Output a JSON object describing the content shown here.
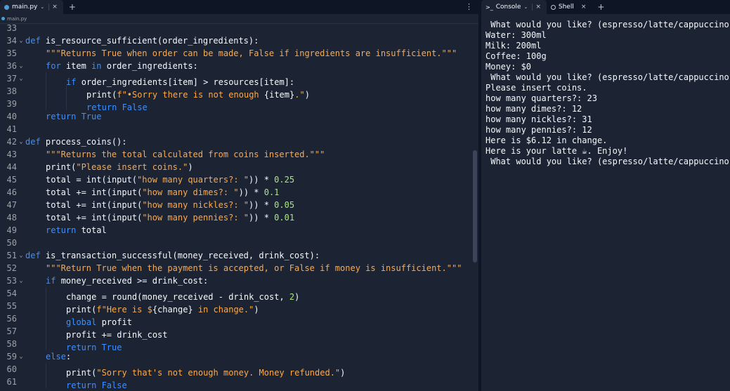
{
  "editor": {
    "tab_label": "main.py",
    "breadcrumb_label": "main.py",
    "tab_close": "×",
    "add_tab": "+",
    "kebab": "⋮"
  },
  "console": {
    "tab_console_label": "Console",
    "tab_shell_label": "Shell",
    "tab_close": "×",
    "add_tab": "+",
    "output": [
      " What would you like? (espresso/latte/cappuccino):",
      "Water: 300ml",
      "Milk: 200ml",
      "Coffee: 100g",
      "Money: $0",
      " What would you like? (espresso/latte/cappuccino):",
      "Please insert coins.",
      "how many quarters?: 23",
      "how many dimes?: 12",
      "how many nickles?: 31",
      "how many pennies?: 12",
      "Here is $6.12 in change.",
      "Here is your latte ☕. Enjoy!",
      " What would you like? (espresso/latte/cappuccino):"
    ]
  },
  "code_lines": [
    {
      "n": "33",
      "fold": "",
      "indent": 0,
      "tokens": []
    },
    {
      "n": "34",
      "fold": "⌄",
      "indent": 0,
      "tokens": [
        [
          "kw",
          "def "
        ],
        [
          "fn",
          "is_resource_sufficient"
        ],
        [
          "op",
          "(order_ingredients):"
        ]
      ]
    },
    {
      "n": "35",
      "fold": "",
      "indent": 1,
      "tokens": [
        [
          "str",
          "\"\"\"Returns True when order can be made, False if ingredients are insufficient.\"\"\""
        ]
      ]
    },
    {
      "n": "36",
      "fold": "⌄",
      "indent": 1,
      "tokens": [
        [
          "kw",
          "for "
        ],
        [
          "op",
          "item "
        ],
        [
          "kw",
          "in "
        ],
        [
          "op",
          "order_ingredients:"
        ]
      ]
    },
    {
      "n": "37",
      "fold": "⌄",
      "indent": 2,
      "tokens": [
        [
          "kw",
          "if "
        ],
        [
          "op",
          "order_ingredients[item] > resources[item]:"
        ]
      ]
    },
    {
      "n": "38",
      "fold": "",
      "indent": 3,
      "tokens": [
        [
          "fn",
          "print"
        ],
        [
          "op",
          "("
        ],
        [
          "str",
          "f\"•Sorry there is not enough "
        ],
        [
          "op",
          "{item}"
        ],
        [
          "str",
          "."
        ],
        [
          "str",
          "\""
        ],
        [
          "op",
          ")"
        ]
      ]
    },
    {
      "n": "39",
      "fold": "",
      "indent": 3,
      "tokens": [
        [
          "kw",
          "return "
        ],
        [
          "kw",
          "False"
        ]
      ]
    },
    {
      "n": "40",
      "fold": "",
      "indent": 1,
      "tokens": [
        [
          "kw",
          "return "
        ],
        [
          "kw",
          "True"
        ]
      ]
    },
    {
      "n": "41",
      "fold": "",
      "indent": 0,
      "tokens": []
    },
    {
      "n": "42",
      "fold": "⌄",
      "indent": 0,
      "tokens": [
        [
          "kw",
          "def "
        ],
        [
          "fn",
          "process_coins"
        ],
        [
          "op",
          "():"
        ]
      ]
    },
    {
      "n": "43",
      "fold": "",
      "indent": 1,
      "tokens": [
        [
          "str",
          "\"\"\"Returns the total calculated from coins inserted.\"\"\""
        ]
      ]
    },
    {
      "n": "44",
      "fold": "",
      "indent": 1,
      "tokens": [
        [
          "fn",
          "print"
        ],
        [
          "op",
          "("
        ],
        [
          "str",
          "\"Please insert coins.\""
        ],
        [
          "op",
          ")"
        ]
      ]
    },
    {
      "n": "45",
      "fold": "",
      "indent": 1,
      "tokens": [
        [
          "op",
          "total = "
        ],
        [
          "fn",
          "int"
        ],
        [
          "op",
          "("
        ],
        [
          "fn",
          "input"
        ],
        [
          "op",
          "("
        ],
        [
          "str",
          "\"how many quarters?: \""
        ],
        [
          "op",
          ")) * "
        ],
        [
          "num",
          "0.25"
        ]
      ]
    },
    {
      "n": "46",
      "fold": "",
      "indent": 1,
      "tokens": [
        [
          "op",
          "total += "
        ],
        [
          "fn",
          "int"
        ],
        [
          "op",
          "("
        ],
        [
          "fn",
          "input"
        ],
        [
          "op",
          "("
        ],
        [
          "str",
          "\"how many dimes?: \""
        ],
        [
          "op",
          ")) * "
        ],
        [
          "num",
          "0.1"
        ]
      ]
    },
    {
      "n": "47",
      "fold": "",
      "indent": 1,
      "tokens": [
        [
          "op",
          "total += "
        ],
        [
          "fn",
          "int"
        ],
        [
          "op",
          "("
        ],
        [
          "fn",
          "input"
        ],
        [
          "op",
          "("
        ],
        [
          "str",
          "\"how many nickles?: \""
        ],
        [
          "op",
          ")) * "
        ],
        [
          "num",
          "0.05"
        ]
      ]
    },
    {
      "n": "48",
      "fold": "",
      "indent": 1,
      "tokens": [
        [
          "op",
          "total += "
        ],
        [
          "fn",
          "int"
        ],
        [
          "op",
          "("
        ],
        [
          "fn",
          "input"
        ],
        [
          "op",
          "("
        ],
        [
          "str",
          "\"how many pennies?: \""
        ],
        [
          "op",
          ")) * "
        ],
        [
          "num",
          "0.01"
        ]
      ]
    },
    {
      "n": "49",
      "fold": "",
      "indent": 1,
      "tokens": [
        [
          "kw",
          "return "
        ],
        [
          "op",
          "total"
        ]
      ]
    },
    {
      "n": "50",
      "fold": "",
      "indent": 0,
      "tokens": []
    },
    {
      "n": "51",
      "fold": "⌄",
      "indent": 0,
      "tokens": [
        [
          "kw",
          "def "
        ],
        [
          "fn",
          "is_transaction_successful"
        ],
        [
          "op",
          "(money_received, drink_cost):"
        ]
      ]
    },
    {
      "n": "52",
      "fold": "",
      "indent": 1,
      "tokens": [
        [
          "str",
          "\"\"\"Return True when the payment is accepted, or False if money is insufficient.\"\"\""
        ]
      ]
    },
    {
      "n": "53",
      "fold": "⌄",
      "indent": 1,
      "tokens": [
        [
          "kw",
          "if "
        ],
        [
          "op",
          "money_received >= drink_cost:"
        ]
      ]
    },
    {
      "n": "54",
      "fold": "",
      "indent": 2,
      "tokens": [
        [
          "op",
          "change = "
        ],
        [
          "fn",
          "round"
        ],
        [
          "op",
          "(money_received - drink_cost, "
        ],
        [
          "num",
          "2"
        ],
        [
          "op",
          ")"
        ]
      ]
    },
    {
      "n": "55",
      "fold": "",
      "indent": 2,
      "tokens": [
        [
          "fn",
          "print"
        ],
        [
          "op",
          "("
        ],
        [
          "str",
          "f\"Here is $"
        ],
        [
          "op",
          "{change}"
        ],
        [
          "str",
          " in change.\""
        ],
        [
          "op",
          ")"
        ]
      ]
    },
    {
      "n": "56",
      "fold": "",
      "indent": 2,
      "tokens": [
        [
          "kw",
          "global "
        ],
        [
          "op",
          "profit"
        ]
      ]
    },
    {
      "n": "57",
      "fold": "",
      "indent": 2,
      "tokens": [
        [
          "op",
          "profit += drink_cost"
        ]
      ]
    },
    {
      "n": "58",
      "fold": "",
      "indent": 2,
      "tokens": [
        [
          "kw",
          "return "
        ],
        [
          "kw",
          "True"
        ]
      ]
    },
    {
      "n": "59",
      "fold": "⌄",
      "indent": 1,
      "tokens": [
        [
          "kw",
          "else"
        ],
        [
          "op",
          ":"
        ]
      ]
    },
    {
      "n": "60",
      "fold": "",
      "indent": 2,
      "tokens": [
        [
          "fn",
          "print"
        ],
        [
          "op",
          "("
        ],
        [
          "str",
          "\"Sorry that's not enough money. Money refunded.\""
        ],
        [
          "op",
          ")"
        ]
      ]
    },
    {
      "n": "61",
      "fold": "",
      "indent": 2,
      "tokens": [
        [
          "kw",
          "return "
        ],
        [
          "kw",
          "False"
        ]
      ]
    }
  ]
}
